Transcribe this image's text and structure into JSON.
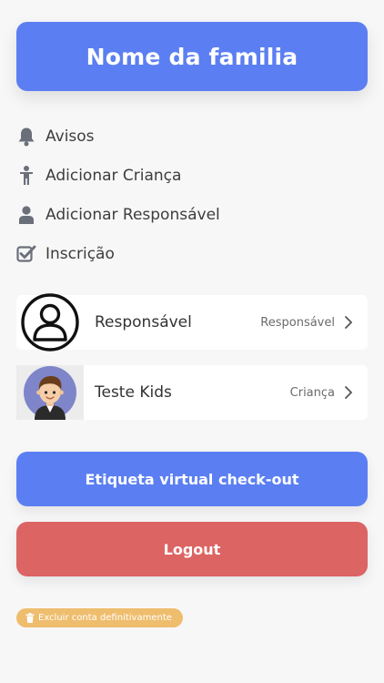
{
  "header": {
    "title": "Nome da familia"
  },
  "menu": {
    "items": [
      {
        "label": "Avisos",
        "icon": "bell-icon"
      },
      {
        "label": "Adicionar Criança",
        "icon": "child-icon"
      },
      {
        "label": "Adicionar Responsável",
        "icon": "person-icon"
      },
      {
        "label": "Inscrição",
        "icon": "checkbox-icon"
      }
    ]
  },
  "people": [
    {
      "name": "Responsável",
      "role": "Responsável",
      "avatar": "user-outline-avatar"
    },
    {
      "name": "Teste Kids",
      "role": "Criança",
      "avatar": "kid-avatar"
    }
  ],
  "buttons": {
    "checkout_label": "Etiqueta virtual check-out",
    "logout_label": "Logout",
    "delete_account_label": "Excluir conta definitivamente"
  },
  "colors": {
    "primary": "#5b7ff2",
    "danger": "#dc6463",
    "warning": "#eebd6d",
    "icon": "#6b6f7a"
  }
}
